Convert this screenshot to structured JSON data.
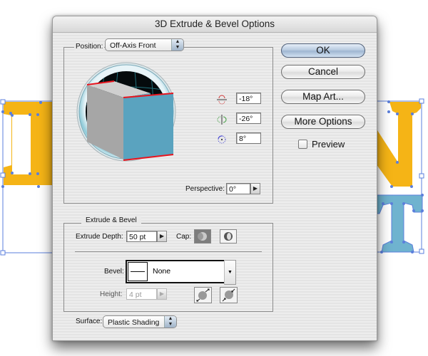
{
  "dialog": {
    "title": "3D Extrude & Bevel Options"
  },
  "position": {
    "label": "Position:",
    "selected": "Off-Axis Front",
    "rotation_x": "-18°",
    "rotation_y": "-26°",
    "rotation_z": "8°",
    "perspective_label": "Perspective:",
    "perspective_value": "0°"
  },
  "buttons": {
    "ok": "OK",
    "cancel": "Cancel",
    "map_art": "Map Art...",
    "more_options": "More Options",
    "preview_label": "Preview",
    "preview_checked": false
  },
  "extrude_bevel": {
    "legend": "Extrude & Bevel",
    "extrude_depth_label": "Extrude Depth:",
    "extrude_depth_value": "50 pt",
    "cap_label": "Cap:",
    "bevel_label": "Bevel:",
    "bevel_value": "None",
    "height_label": "Height:",
    "height_value": "4 pt"
  },
  "surface": {
    "label": "Surface:",
    "selected": "Plastic Shading"
  },
  "colors": {
    "letter_orange": "#f5b416",
    "letter_blue": "#6fb3cf",
    "selection_blue": "#5b7fdc",
    "cube_front": "#5aa3bf",
    "cube_edge_red": "#e8141e"
  }
}
